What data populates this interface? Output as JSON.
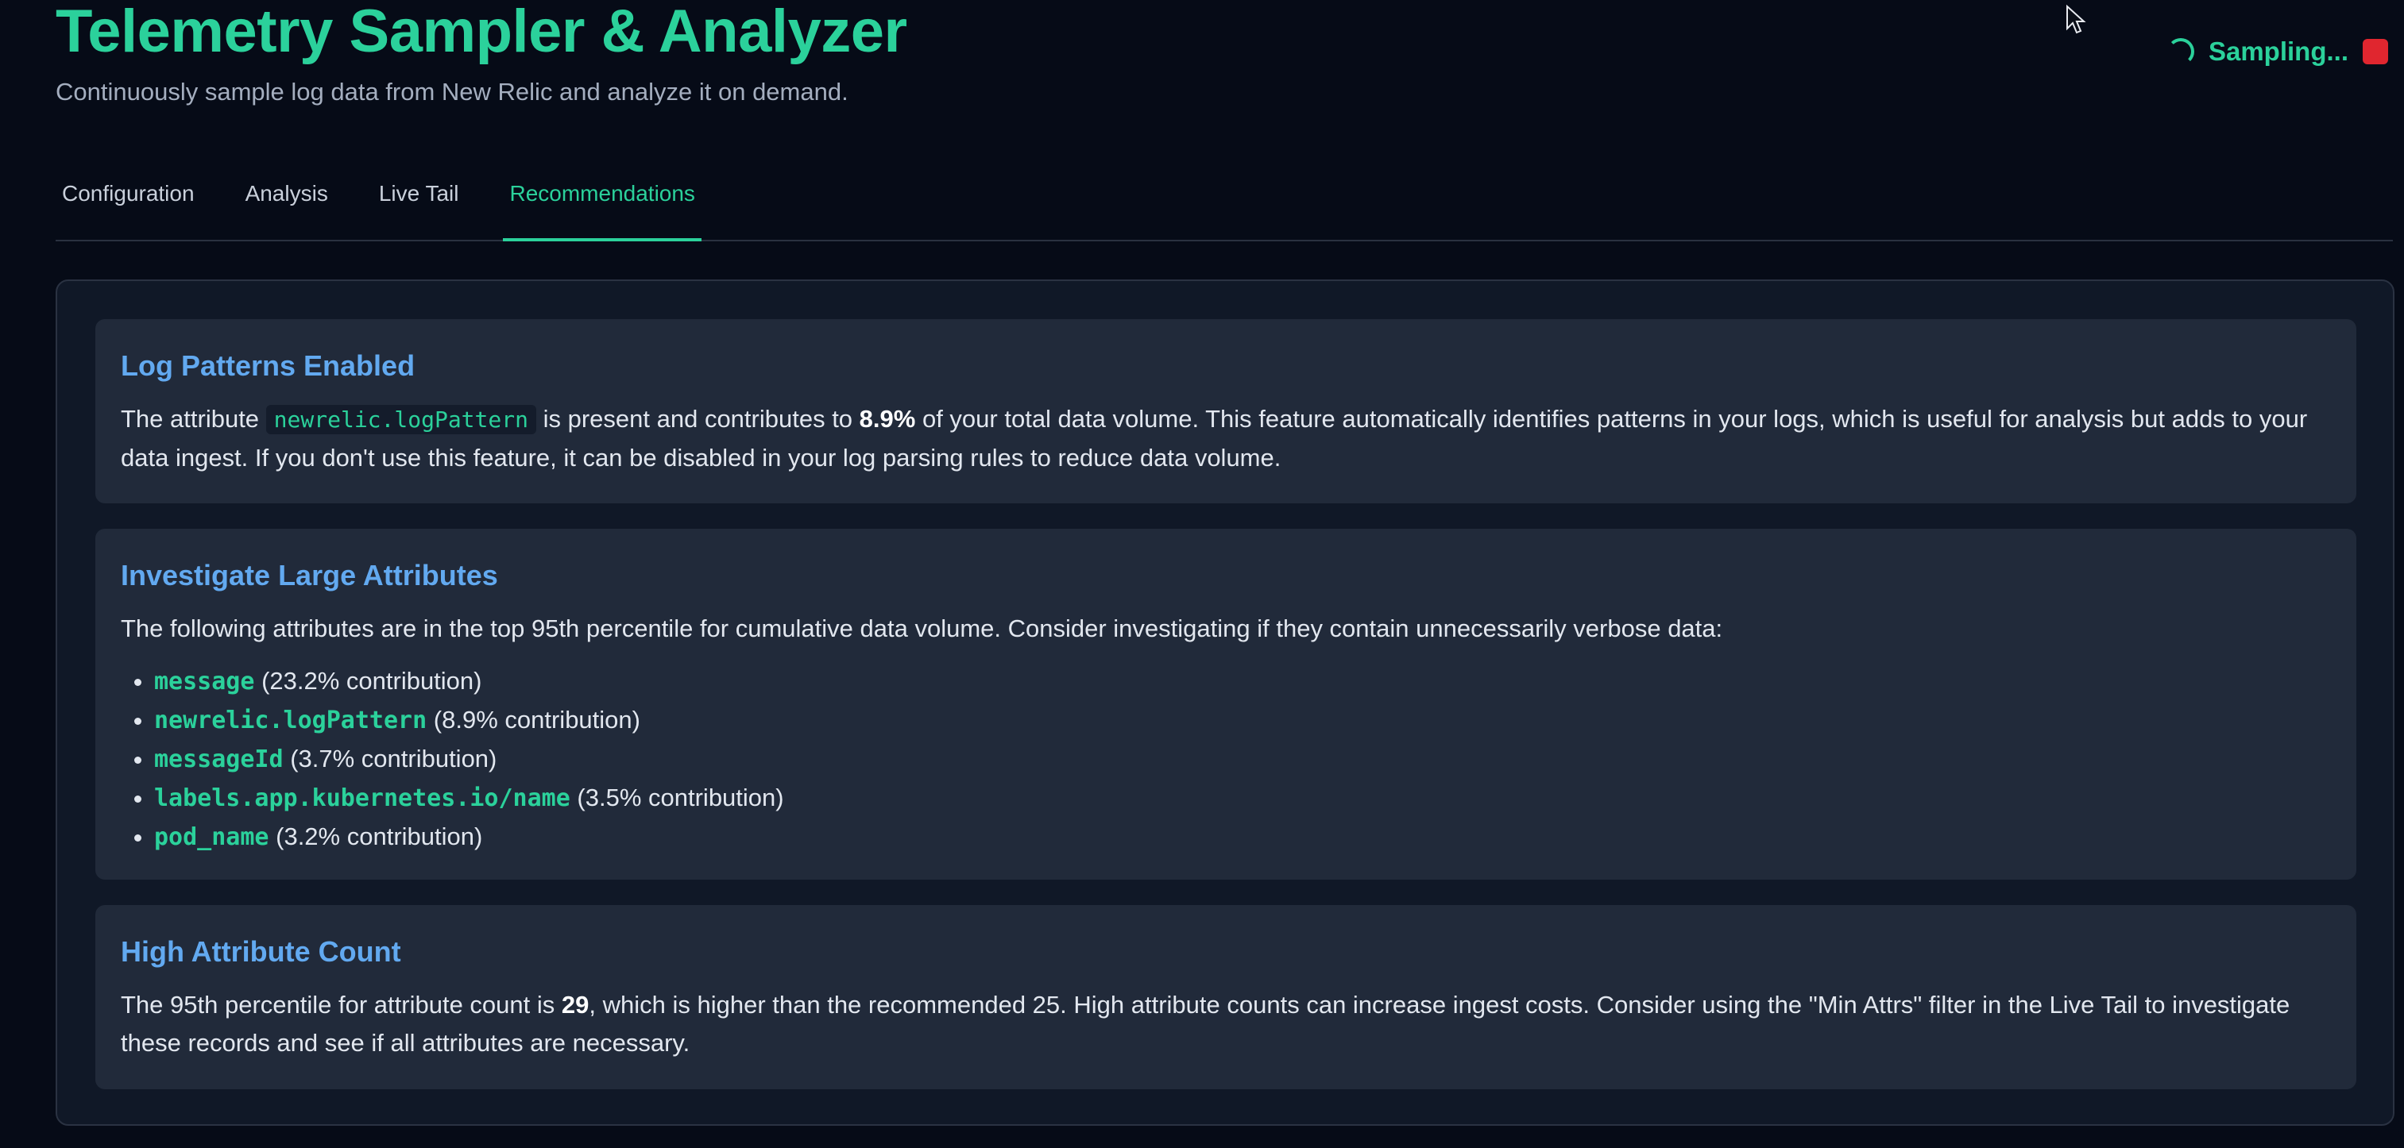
{
  "app": {
    "title": "Telemetry Sampler & Analyzer",
    "subtitle": "Continuously sample log data from New Relic and analyze it on demand."
  },
  "status": {
    "label": "Sampling...",
    "accent": "#2bd19b",
    "stop_color": "#e0262f"
  },
  "tabs": [
    {
      "label": "Configuration",
      "active": false
    },
    {
      "label": "Analysis",
      "active": false
    },
    {
      "label": "Live Tail",
      "active": false
    },
    {
      "label": "Recommendations",
      "active": true
    }
  ],
  "cards": {
    "log_patterns": {
      "title": "Log Patterns Enabled",
      "text_1": "The attribute",
      "code": "newrelic.logPattern",
      "text_2": "is present and contributes to",
      "percent": "8.9%",
      "text_3": "of your total data volume. This feature automatically identifies patterns in your logs, which is useful for analysis but adds to your data ingest. If you don't use this feature, it can be disabled in your log parsing rules to reduce data volume."
    },
    "large_attributes": {
      "title": "Investigate Large Attributes",
      "intro": "The following attributes are in the top 95th percentile for cumulative data volume. Consider investigating if they contain unnecessarily verbose data:",
      "items": [
        {
          "name": "message",
          "detail": "(23.2% contribution)"
        },
        {
          "name": "newrelic.logPattern",
          "detail": "(8.9% contribution)"
        },
        {
          "name": "messageId",
          "detail": "(3.7% contribution)"
        },
        {
          "name": "labels.app.kubernetes.io/name",
          "detail": "(3.5% contribution)"
        },
        {
          "name": "pod_name",
          "detail": "(3.2% contribution)"
        }
      ]
    },
    "attribute_count": {
      "title": "High Attribute Count",
      "text_1": "The 95th percentile for attribute count is",
      "value": "29",
      "text_2": ", which is higher than the recommended 25. High attribute counts can increase ingest costs. Consider using the \"Min Attrs\" filter in the Live Tail to investigate these records and see if all attributes are necessary."
    }
  }
}
